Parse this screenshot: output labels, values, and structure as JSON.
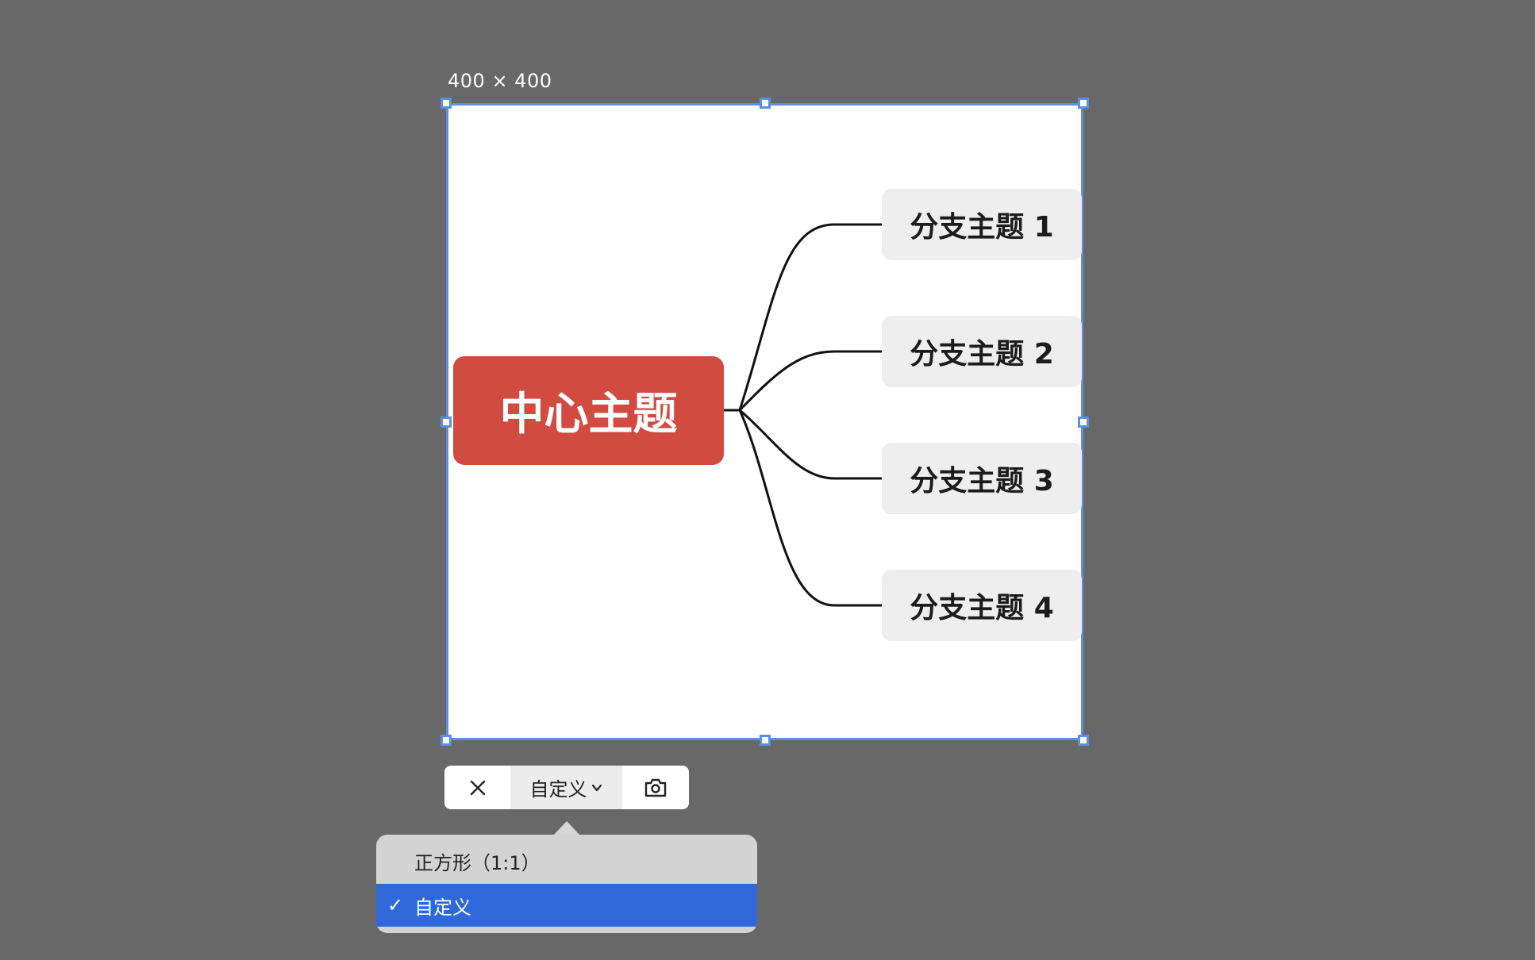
{
  "size_label": "400 × 400",
  "mindmap": {
    "central_topic": "中心主题",
    "branches": [
      "分支主题 1",
      "分支主题 2",
      "分支主题 3",
      "分支主题 4"
    ],
    "colors": {
      "central_fill": "#d24b40",
      "branch_fill": "#eeeeee",
      "connector": "#111111"
    }
  },
  "selection": {
    "border_color": "#5b8fe0"
  },
  "toolbar": {
    "close_icon": "close-icon",
    "ratio_label": "自定义",
    "ratio_icon": "chevron-down-icon",
    "capture_icon": "camera-icon"
  },
  "ratio_menu": {
    "items": [
      {
        "label": "正方形（1:1）",
        "selected": false
      },
      {
        "label": "自定义",
        "selected": true
      }
    ],
    "check_glyph": "✓",
    "selected_color": "#2f69d9"
  }
}
